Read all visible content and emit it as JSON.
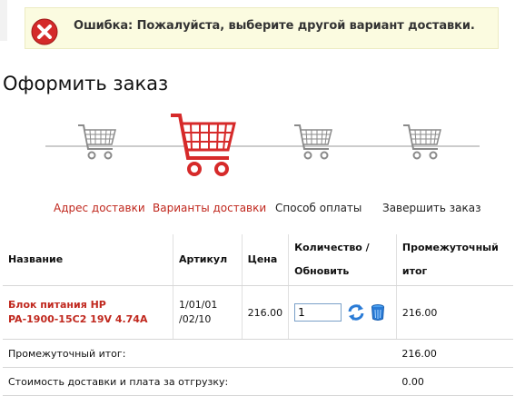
{
  "alert": {
    "icon": "error-x-icon",
    "message": "Ошибка: Пожалуйста, выберите другой вариант доставки.",
    "color": "#cc2233"
  },
  "page": {
    "title": "Оформить заказ"
  },
  "steps": [
    {
      "label": "Адрес доставки",
      "icon": "cart-icon",
      "active": false,
      "color": "#c0281e"
    },
    {
      "label": "Варианты доставки",
      "icon": "cart-icon",
      "active": true,
      "color": "#c0281e"
    },
    {
      "label": "Способ оплаты",
      "icon": "cart-icon",
      "active": false,
      "color": "#222222"
    },
    {
      "label": "Завершить заказ",
      "icon": "cart-icon",
      "active": false,
      "color": "#222222"
    }
  ],
  "table": {
    "headers": {
      "name": "Название",
      "sku": "Артикул",
      "price": "Цена",
      "qty_line1": "Количество /",
      "qty_line2": "Обновить",
      "subtotal_line1": "Промежуточный",
      "subtotal_line2": "итог"
    },
    "items": [
      {
        "name_line1": "Блок питания HP",
        "name_line2": "PA-1900-15C2 19V 4.74A",
        "sku_line1": "1/01/01",
        "sku_line2": "/02/10",
        "price": "216.00",
        "qty": "1",
        "subtotal": "216.00"
      }
    ],
    "summary": {
      "subtotal_label": "Промежуточный итог:",
      "subtotal_value": "216.00",
      "shipping_label": "Стоимость доставки и плата за отгрузку:",
      "shipping_value": "0.00"
    }
  }
}
